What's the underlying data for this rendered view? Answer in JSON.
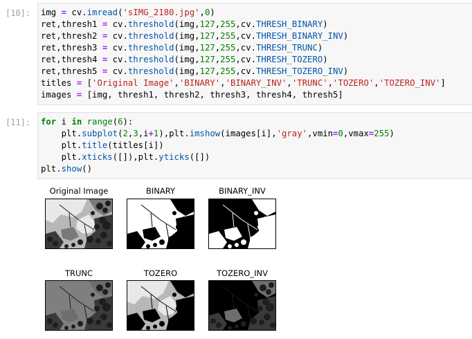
{
  "cell10": {
    "prompt": "[10]:",
    "lines": [
      [
        [
          "t",
          "img "
        ],
        [
          "o",
          "="
        ],
        [
          "t",
          " cv."
        ],
        [
          "a",
          "imread"
        ],
        [
          "t",
          "("
        ],
        [
          "s",
          "'sIMG_2180.jpg'"
        ],
        [
          "t",
          ","
        ],
        [
          "n",
          "0"
        ],
        [
          "t",
          ")"
        ]
      ],
      [
        [
          "t",
          "ret,thresh1 "
        ],
        [
          "o",
          "="
        ],
        [
          "t",
          " cv."
        ],
        [
          "a",
          "threshold"
        ],
        [
          "t",
          "(img,"
        ],
        [
          "n",
          "127"
        ],
        [
          "t",
          ","
        ],
        [
          "n",
          "255"
        ],
        [
          "t",
          ",cv."
        ],
        [
          "a",
          "THRESH_BINARY"
        ],
        [
          "t",
          ")"
        ]
      ],
      [
        [
          "t",
          "ret,thresh2 "
        ],
        [
          "o",
          "="
        ],
        [
          "t",
          " cv."
        ],
        [
          "a",
          "threshold"
        ],
        [
          "t",
          "(img,"
        ],
        [
          "n",
          "127"
        ],
        [
          "t",
          ","
        ],
        [
          "n",
          "255"
        ],
        [
          "t",
          ",cv."
        ],
        [
          "a",
          "THRESH_BINARY_INV"
        ],
        [
          "t",
          ")"
        ]
      ],
      [
        [
          "t",
          "ret,thresh3 "
        ],
        [
          "o",
          "="
        ],
        [
          "t",
          " cv."
        ],
        [
          "a",
          "threshold"
        ],
        [
          "t",
          "(img,"
        ],
        [
          "n",
          "127"
        ],
        [
          "t",
          ","
        ],
        [
          "n",
          "255"
        ],
        [
          "t",
          ",cv."
        ],
        [
          "a",
          "THRESH_TRUNC"
        ],
        [
          "t",
          ")"
        ]
      ],
      [
        [
          "t",
          "ret,thresh4 "
        ],
        [
          "o",
          "="
        ],
        [
          "t",
          " cv."
        ],
        [
          "a",
          "threshold"
        ],
        [
          "t",
          "(img,"
        ],
        [
          "n",
          "127"
        ],
        [
          "t",
          ","
        ],
        [
          "n",
          "255"
        ],
        [
          "t",
          ",cv."
        ],
        [
          "a",
          "THRESH_TOZERO"
        ],
        [
          "t",
          ")"
        ]
      ],
      [
        [
          "t",
          "ret,thresh5 "
        ],
        [
          "o",
          "="
        ],
        [
          "t",
          " cv."
        ],
        [
          "a",
          "threshold"
        ],
        [
          "t",
          "(img,"
        ],
        [
          "n",
          "127"
        ],
        [
          "t",
          ","
        ],
        [
          "n",
          "255"
        ],
        [
          "t",
          ",cv."
        ],
        [
          "a",
          "THRESH_TOZERO_INV"
        ],
        [
          "t",
          ")"
        ]
      ],
      [
        [
          "t",
          "titles "
        ],
        [
          "o",
          "="
        ],
        [
          "t",
          " ["
        ],
        [
          "s",
          "'Original Image'"
        ],
        [
          "t",
          ","
        ],
        [
          "s",
          "'BINARY'"
        ],
        [
          "t",
          ","
        ],
        [
          "s",
          "'BINARY_INV'"
        ],
        [
          "t",
          ","
        ],
        [
          "s",
          "'TRUNC'"
        ],
        [
          "t",
          ","
        ],
        [
          "s",
          "'TOZERO'"
        ],
        [
          "t",
          ","
        ],
        [
          "s",
          "'TOZERO_INV'"
        ],
        [
          "t",
          "]"
        ]
      ],
      [
        [
          "t",
          "images "
        ],
        [
          "o",
          "="
        ],
        [
          "t",
          " [img, thresh1, thresh2, thresh3, thresh4, thresh5]"
        ]
      ]
    ]
  },
  "cell11": {
    "prompt": "[11]:",
    "lines": [
      [
        [
          "k",
          "for"
        ],
        [
          "t",
          " i "
        ],
        [
          "k",
          "in"
        ],
        [
          "t",
          " "
        ],
        [
          "b",
          "range"
        ],
        [
          "t",
          "("
        ],
        [
          "n",
          "6"
        ],
        [
          "t",
          "):"
        ]
      ],
      [
        [
          "t",
          "    plt."
        ],
        [
          "a",
          "subplot"
        ],
        [
          "t",
          "("
        ],
        [
          "n",
          "2"
        ],
        [
          "t",
          ","
        ],
        [
          "n",
          "3"
        ],
        [
          "t",
          ",i"
        ],
        [
          "o",
          "+"
        ],
        [
          "n",
          "1"
        ],
        [
          "t",
          "),plt."
        ],
        [
          "a",
          "imshow"
        ],
        [
          "t",
          "(images[i],"
        ],
        [
          "s",
          "'gray'"
        ],
        [
          "t",
          ",vmin"
        ],
        [
          "o",
          "="
        ],
        [
          "n",
          "0"
        ],
        [
          "t",
          ",vmax"
        ],
        [
          "o",
          "="
        ],
        [
          "n",
          "255"
        ],
        [
          "t",
          ")"
        ]
      ],
      [
        [
          "t",
          "    plt."
        ],
        [
          "a",
          "title"
        ],
        [
          "t",
          "(titles[i])"
        ]
      ],
      [
        [
          "t",
          "    plt."
        ],
        [
          "a",
          "xticks"
        ],
        [
          "t",
          "([]),plt."
        ],
        [
          "a",
          "yticks"
        ],
        [
          "t",
          "([])"
        ]
      ],
      [
        [
          "t",
          "plt."
        ],
        [
          "a",
          "show"
        ],
        [
          "t",
          "()"
        ]
      ]
    ]
  },
  "output": {
    "titles": [
      "Original Image",
      "BINARY",
      "BINARY_INV",
      "TRUNC",
      "TOZERO",
      "TOZERO_INV"
    ],
    "variants": [
      "original",
      "binary",
      "binary_inv",
      "trunc",
      "tozero",
      "tozero_inv"
    ]
  }
}
